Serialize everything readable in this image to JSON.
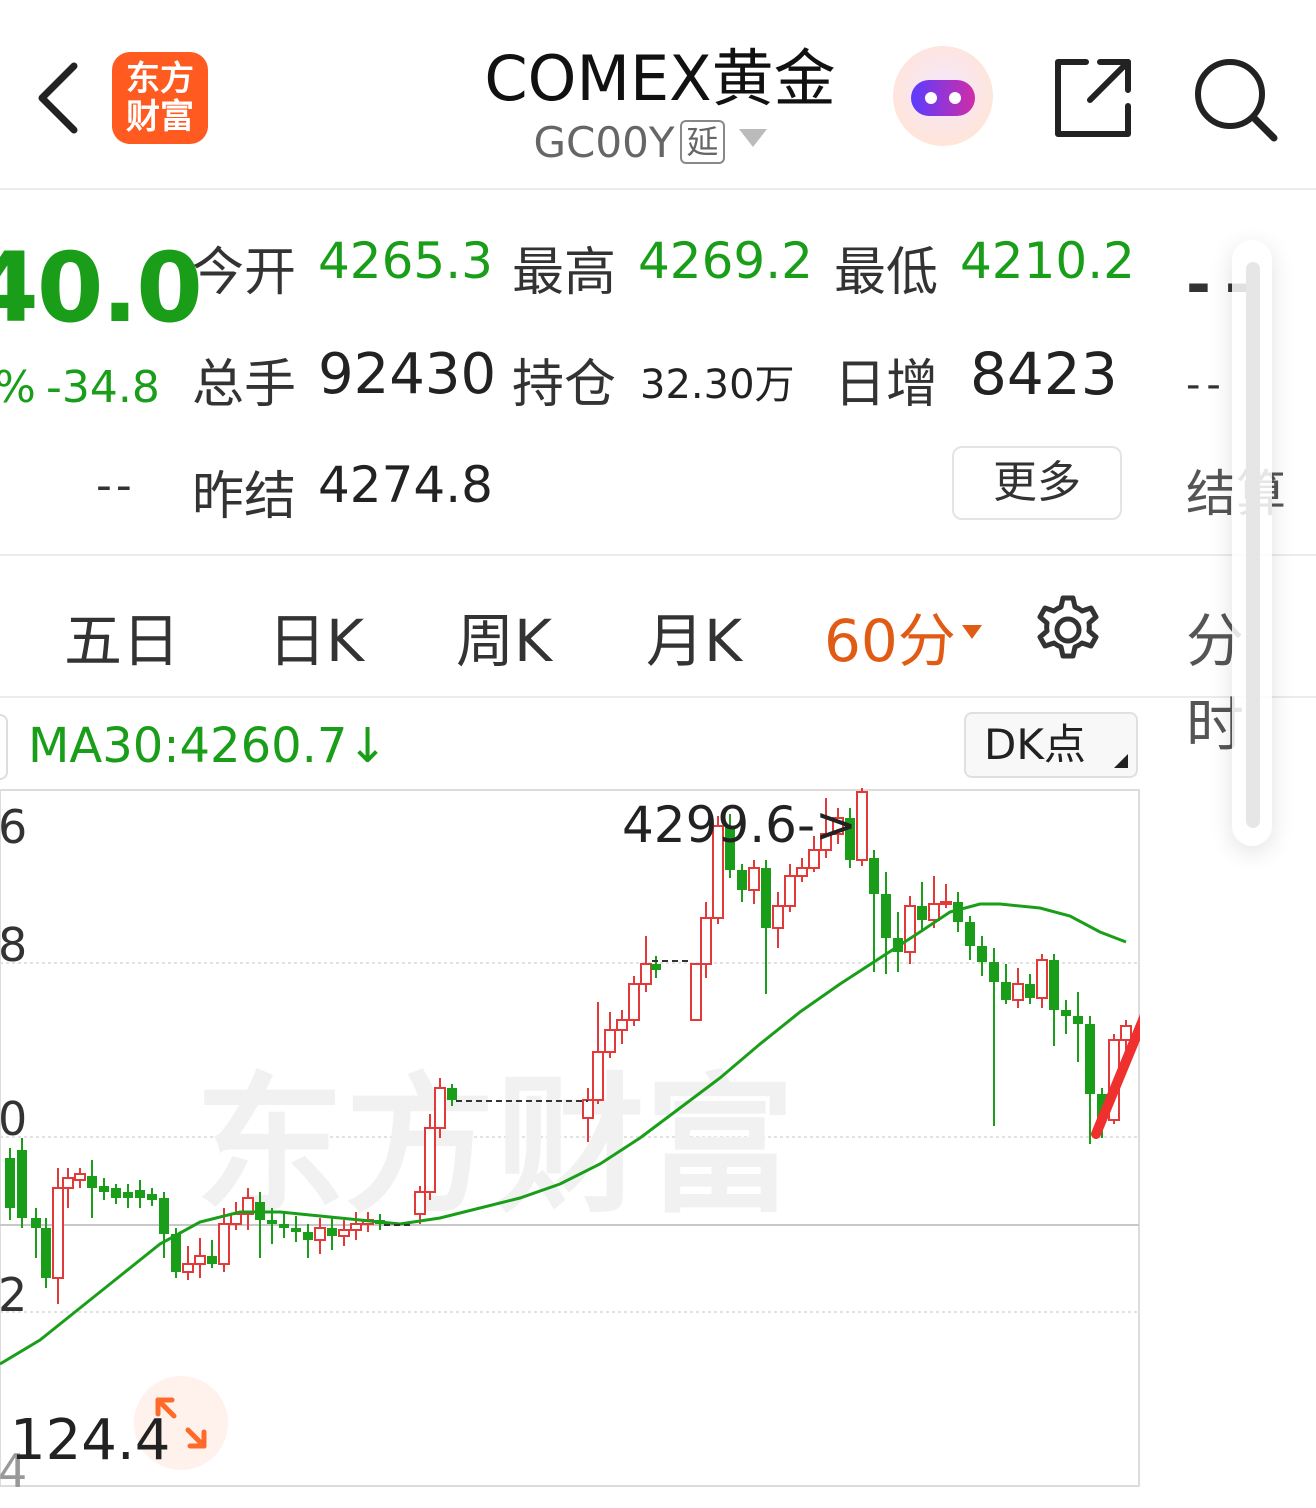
{
  "header": {
    "back": "back",
    "logo_line1": "东方",
    "logo_line2": "财富",
    "title": "COMEX黄金",
    "code": "GC00Y",
    "delay_tag": "延"
  },
  "quote": {
    "price": "40.0",
    "pct": "%",
    "change": "-34.8",
    "dashes": "--",
    "items": [
      {
        "label": "今开",
        "value": "4265.3"
      },
      {
        "label": "最高",
        "value": "4269.2"
      },
      {
        "label": "最低",
        "value": "4210.2"
      },
      {
        "label": "总手",
        "value": "92430"
      },
      {
        "label": "持仓",
        "value": "32.30万"
      },
      {
        "label": "日增",
        "value": "8423"
      },
      {
        "label": "昨结",
        "value": "4274.8"
      }
    ],
    "more": "更多",
    "right_cut_1": "--",
    "right_cut_2": "--",
    "right_cut_3": "结算"
  },
  "tabs": {
    "items": [
      "五日",
      "日K",
      "周K",
      "月K",
      "60分"
    ],
    "active_index": 4,
    "right_cut": "分时"
  },
  "ma": {
    "text": "MA30:4260.7↓",
    "dk_button": "DK点"
  },
  "chart_data": {
    "type": "candlestick",
    "y_tick_labels": [
      "6",
      "8",
      "0",
      "2",
      "4"
    ],
    "high_annotation": "4299.6->",
    "low_annotation": "124.4",
    "watermark": "东方财富",
    "ma30_value": 4260.7,
    "colors": {
      "up": "#e23a3a",
      "down": "#1a9e1a",
      "ma": "#1a9e1a",
      "arrow_up": "#f02f2f",
      "arrow_down": "#7fd41a"
    }
  }
}
